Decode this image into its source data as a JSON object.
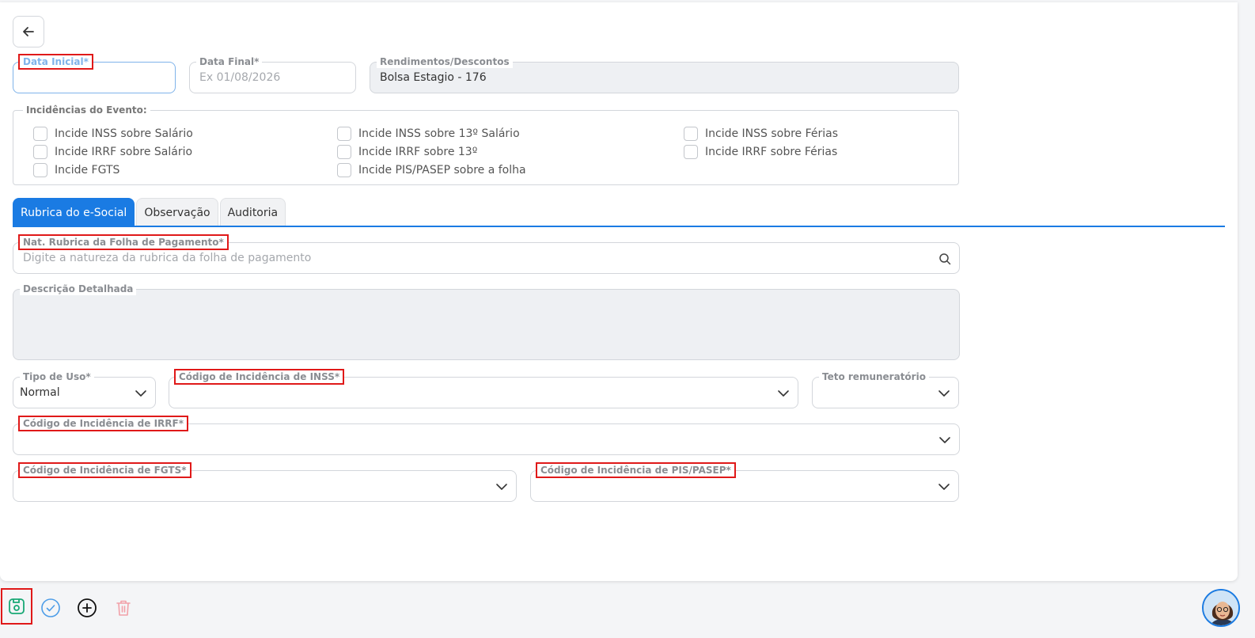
{
  "form": {
    "data_inicial": {
      "label": "Data Inicial*",
      "value": ""
    },
    "data_final": {
      "label": "Data Final*",
      "placeholder": "Ex 01/08/2026"
    },
    "rendimentos": {
      "label": "Rendimentos/Descontos",
      "value": "Bolsa Estagio - 176"
    }
  },
  "incidencias": {
    "title": "Incidências do Evento:",
    "items": [
      "Incide INSS sobre Salário",
      "Incide IRRF sobre Salário",
      "Incide FGTS",
      "Incide INSS sobre 13º Salário",
      "Incide IRRF sobre 13º",
      "Incide PIS/PASEP sobre a folha",
      "Incide INSS sobre Férias",
      "Incide IRRF sobre Férias"
    ]
  },
  "tabs": [
    {
      "label": "Rubrica do e-Social",
      "active": true
    },
    {
      "label": "Observação",
      "active": false
    },
    {
      "label": "Auditoria",
      "active": false
    }
  ],
  "rubrica": {
    "natureza": {
      "label": "Nat. Rubrica da Folha de Pagamento*",
      "placeholder": "Digite a natureza da rubrica da folha de pagamento"
    },
    "descricao": {
      "label": "Descrição Detalhada",
      "value": ""
    },
    "tipo_uso": {
      "label": "Tipo de Uso*",
      "value": "Normal"
    },
    "cod_inss": {
      "label": "Código de Incidência de INSS*",
      "value": ""
    },
    "teto": {
      "label": "Teto remuneratório",
      "value": ""
    },
    "cod_irrf": {
      "label": "Código de Incidência de IRRF*",
      "value": ""
    },
    "cod_fgts": {
      "label": "Código de Incidência de FGTS*",
      "value": ""
    },
    "cod_pis": {
      "label": "Código de Incidência de PIS/PASEP*",
      "value": ""
    }
  },
  "toolbar": {
    "icons": [
      "save-icon",
      "check-circle-icon",
      "plus-circle-icon",
      "trash-icon"
    ]
  },
  "colors": {
    "accent": "#1a7be3",
    "highlight": "#e01919",
    "save": "#19a875",
    "delete": "#f2a0a8"
  }
}
